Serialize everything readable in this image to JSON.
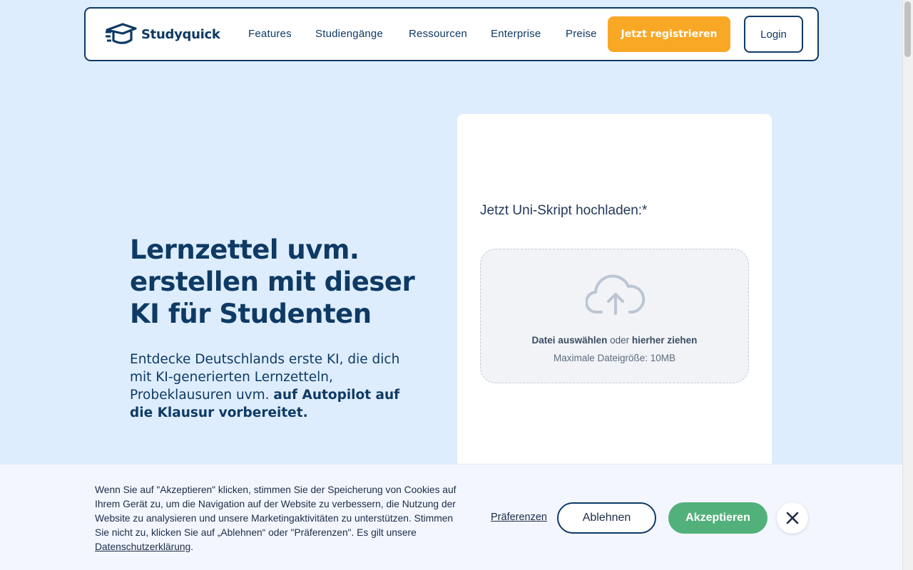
{
  "brand": {
    "name": "Studyquick",
    "logo_icon": "graduation-cap-icon"
  },
  "nav": {
    "links": [
      "Features",
      "Studiengänge",
      "Ressourcen",
      "Enterprise",
      "Preise"
    ],
    "register_label": "Jetzt registrieren",
    "login_label": "Login"
  },
  "hero": {
    "title": "Lernzettel uvm. erstellen mit dieser KI für Studenten",
    "subtitle_plain": "Entdecke Deutschlands erste KI, die dich mit KI-generierten Lernzetteln, Probeklausuren uvm.",
    "subtitle_bold": "auf Autopilot auf die Klausur vorbereitet."
  },
  "upload": {
    "label": "Jetzt Uni-Skript hochladen:*",
    "select_file": "Datei auswählen",
    "or": "oder",
    "drag_here": "hierher ziehen",
    "max_size": "Maximale Dateigröße: 10MB",
    "icon": "cloud-upload-icon"
  },
  "cookie": {
    "text": "Wenn Sie auf \"Akzeptieren\" klicken, stimmen Sie der Speicherung von Cookies auf Ihrem Gerät zu, um die Navigation auf der Website zu verbessern, die Nutzung der Website zu analysieren und unsere Marketingaktivitäten zu unterstützen. Stimmen Sie nicht zu, klicken Sie auf „Ablehnen“ oder \"Präferenzen\". Es gilt unsere",
    "privacy_link": "Datenschutzerklärung",
    "trailing": ".",
    "preferences_label": "Präferenzen",
    "reject_label": "Ablehnen",
    "accept_label": "Akzeptieren",
    "close_icon": "close-icon"
  },
  "colors": {
    "background": "#deedfd",
    "primary": "#0e3a64",
    "accent_orange": "#f9a825",
    "accept_green": "#52b17a"
  }
}
